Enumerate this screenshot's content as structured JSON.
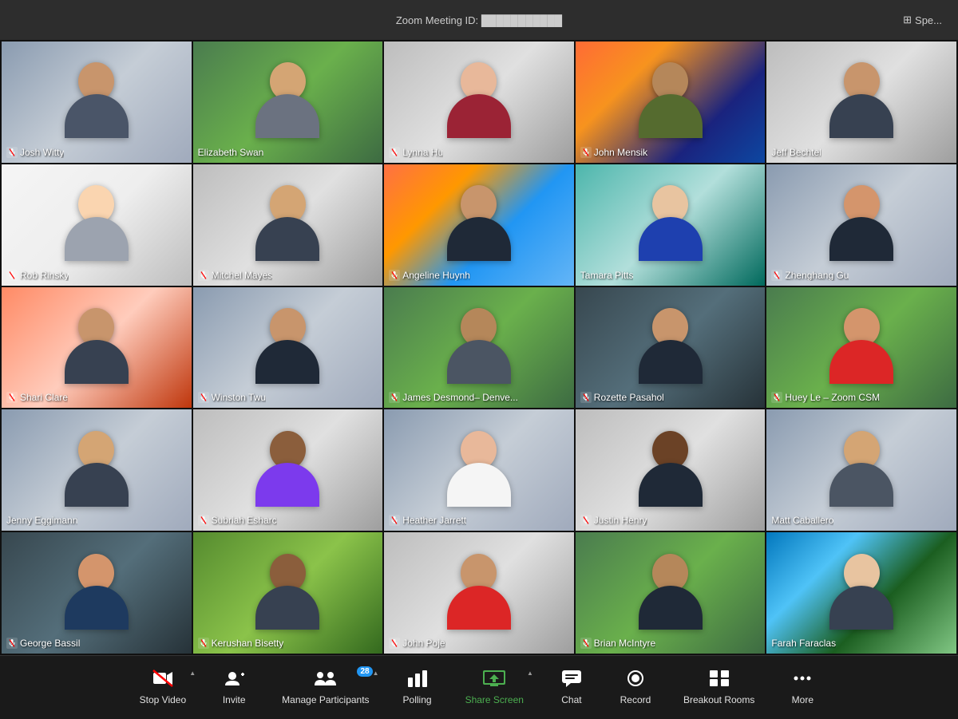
{
  "app": {
    "title": "Zoom Meeting",
    "meeting_id_label": "Zoom Meeting ID:",
    "meeting_id": "███████████",
    "speaker_mode": "Spe..."
  },
  "participants": [
    {
      "id": 1,
      "name": "Josh Witty",
      "mic_off": true,
      "bg": "bg-office",
      "active": false,
      "skin": "#c8956c",
      "shirt": "#4a5568"
    },
    {
      "id": 2,
      "name": "Elizabeth Swan",
      "mic_off": false,
      "bg": "bg-green",
      "active": false,
      "skin": "#d4a574",
      "shirt": "#6b7280"
    },
    {
      "id": 3,
      "name": "Lynna Hu",
      "mic_off": true,
      "bg": "bg-cubicle",
      "active": false,
      "skin": "#e8b89a",
      "shirt": "#9b2335"
    },
    {
      "id": 4,
      "name": "John Mensik",
      "mic_off": true,
      "bg": "bg-sunset",
      "active": false,
      "skin": "#b5875a",
      "shirt": "#556b2f"
    },
    {
      "id": 5,
      "name": "Jeff Bechtel",
      "mic_off": false,
      "bg": "bg-cubicle",
      "active": false,
      "skin": "#c8956c",
      "shirt": "#374151"
    },
    {
      "id": 6,
      "name": "Rob Rinsky",
      "mic_off": true,
      "bg": "bg-bright",
      "active": false,
      "skin": "#fad5b0",
      "shirt": "#9ca3af"
    },
    {
      "id": 7,
      "name": "Mitchel Mayes",
      "mic_off": true,
      "bg": "bg-cubicle",
      "active": false,
      "skin": "#d4a574",
      "shirt": "#374151"
    },
    {
      "id": 8,
      "name": "Angeline Huynh",
      "mic_off": true,
      "bg": "bg-beach",
      "active": false,
      "skin": "#c8956c",
      "shirt": "#1f2937"
    },
    {
      "id": 9,
      "name": "Tamara Pitts",
      "mic_off": false,
      "bg": "bg-cool",
      "active": false,
      "skin": "#e8c4a0",
      "shirt": "#1e40af"
    },
    {
      "id": 10,
      "name": "Zhenghang Gu",
      "mic_off": true,
      "bg": "bg-office",
      "active": false,
      "skin": "#d4956c",
      "shirt": "#1f2937"
    },
    {
      "id": 11,
      "name": "Shari Clare",
      "mic_off": true,
      "bg": "bg-warm",
      "active": false,
      "skin": "#c8956c",
      "shirt": "#374151"
    },
    {
      "id": 12,
      "name": "Winston Twu",
      "mic_off": true,
      "bg": "bg-office",
      "active": false,
      "skin": "#c8956c",
      "shirt": "#1f2937"
    },
    {
      "id": 13,
      "name": "James Desmond– Denve...",
      "mic_off": true,
      "bg": "bg-green",
      "active": false,
      "skin": "#b5875a",
      "shirt": "#4b5563"
    },
    {
      "id": 14,
      "name": "Rozette Pasahol",
      "mic_off": true,
      "bg": "bg-dark-office",
      "active": false,
      "skin": "#c8956c",
      "shirt": "#1f2937"
    },
    {
      "id": 15,
      "name": "Huey Le – Zoom CSM",
      "mic_off": true,
      "bg": "bg-green",
      "active": false,
      "skin": "#d4956c",
      "shirt": "#dc2626"
    },
    {
      "id": 16,
      "name": "Jenny Eggimann",
      "mic_off": false,
      "bg": "bg-office",
      "active": false,
      "skin": "#d4a574",
      "shirt": "#374151"
    },
    {
      "id": 17,
      "name": "Subriah Esharc",
      "mic_off": true,
      "bg": "bg-cubicle",
      "active": false,
      "skin": "#8b5e3c",
      "shirt": "#7c3aed"
    },
    {
      "id": 18,
      "name": "Heather Jarrett",
      "mic_off": true,
      "bg": "bg-office",
      "active": false,
      "skin": "#e8b89a",
      "shirt": "#f5f5f5"
    },
    {
      "id": 19,
      "name": "Justin Henry",
      "mic_off": true,
      "bg": "bg-cubicle",
      "active": false,
      "skin": "#6b4226",
      "shirt": "#1f2937"
    },
    {
      "id": 20,
      "name": "Matt Caballero",
      "mic_off": false,
      "bg": "bg-office",
      "active": false,
      "skin": "#d4a574",
      "shirt": "#4b5563"
    },
    {
      "id": 21,
      "name": "George Bassil",
      "mic_off": true,
      "bg": "bg-dark-office",
      "active": false,
      "skin": "#d4956c",
      "shirt": "#1e3a5f"
    },
    {
      "id": 22,
      "name": "Kerushan Bisetty",
      "mic_off": true,
      "bg": "bg-outdoor",
      "active": false,
      "skin": "#8b5e3c",
      "shirt": "#374151"
    },
    {
      "id": 23,
      "name": "John Poje",
      "mic_off": true,
      "bg": "bg-cubicle",
      "active": false,
      "skin": "#c8956c",
      "shirt": "#dc2626"
    },
    {
      "id": 24,
      "name": "Brian McIntyre",
      "mic_off": true,
      "bg": "bg-green",
      "active": false,
      "skin": "#b5875a",
      "shirt": "#1f2937"
    },
    {
      "id": 25,
      "name": "Farah Faraclas",
      "mic_off": false,
      "bg": "bg-mountain",
      "active": true,
      "skin": "#e8c4a0",
      "shirt": "#374151"
    }
  ],
  "toolbar": {
    "stop_video": {
      "label": "Stop Video",
      "icon": "video"
    },
    "invite": {
      "label": "Invite",
      "icon": "person-plus"
    },
    "manage_participants": {
      "label": "Manage Participants",
      "icon": "people",
      "badge": "28"
    },
    "polling": {
      "label": "Polling",
      "icon": "chart"
    },
    "share_screen": {
      "label": "Share Screen",
      "icon": "share"
    },
    "chat": {
      "label": "Chat",
      "icon": "chat"
    },
    "record": {
      "label": "Record",
      "icon": "circle"
    },
    "breakout_rooms": {
      "label": "Breakout Rooms",
      "icon": "grid"
    },
    "more": {
      "label": "More",
      "icon": "ellipsis"
    }
  }
}
